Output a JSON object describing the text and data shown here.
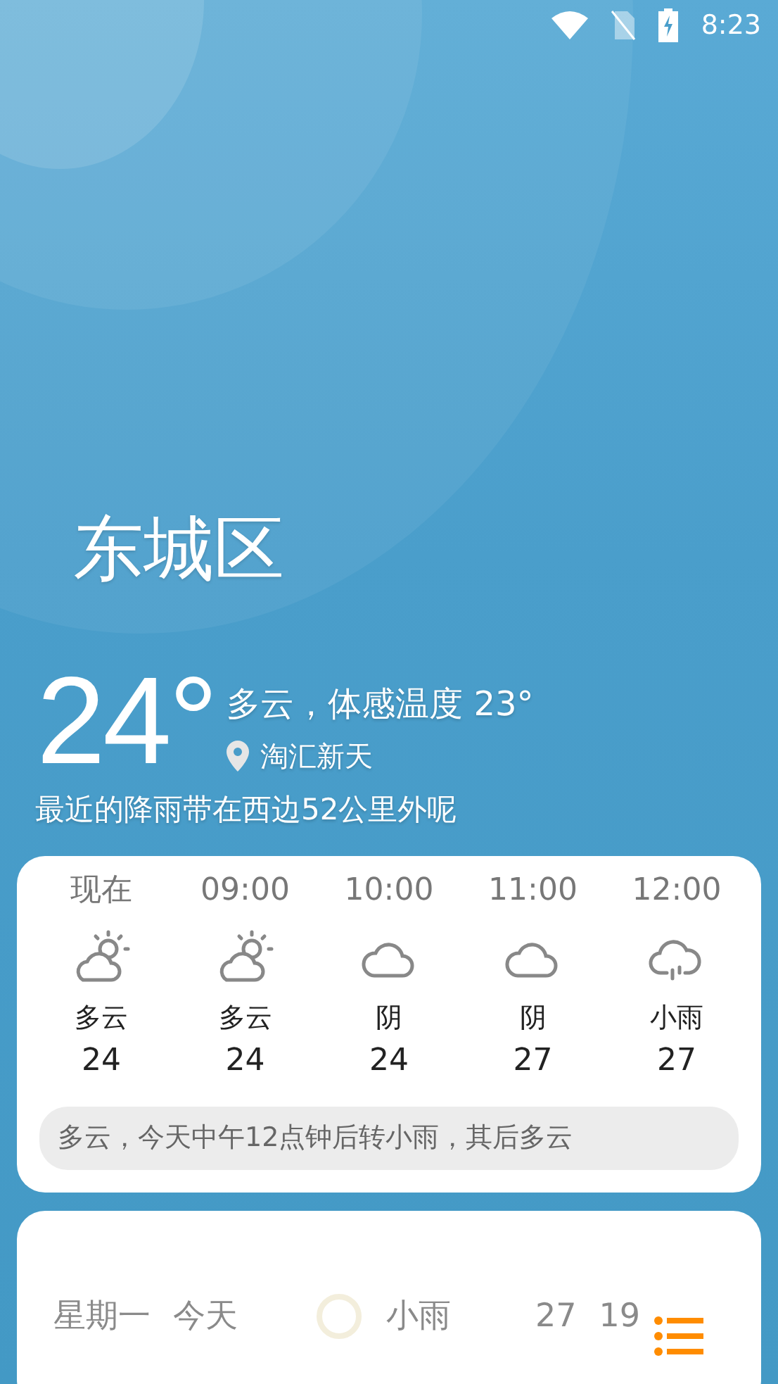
{
  "status_bar": {
    "time": "8:23"
  },
  "city": "东城区",
  "current": {
    "temperature": "24°",
    "condition": "多云，体感温度 23°",
    "location": "淘汇新天",
    "rain_note": "最近的降雨带在西边52公里外呢"
  },
  "hourly": [
    {
      "time": "现在",
      "kind": "partly-cloudy",
      "condition": "多云",
      "temperature": "24"
    },
    {
      "time": "09:00",
      "kind": "partly-cloudy",
      "condition": "多云",
      "temperature": "24"
    },
    {
      "time": "10:00",
      "kind": "cloudy",
      "condition": "阴",
      "temperature": "24"
    },
    {
      "time": "11:00",
      "kind": "cloudy",
      "condition": "阴",
      "temperature": "27"
    },
    {
      "time": "12:00",
      "kind": "rain",
      "condition": "小雨",
      "temperature": "27"
    }
  ],
  "hourly_summary": "多云，今天中午12点钟后转小雨，其后多云",
  "daily": [
    {
      "day": "星期一",
      "label": "今天",
      "condition": "小雨",
      "high": "27",
      "low": "19"
    }
  ]
}
